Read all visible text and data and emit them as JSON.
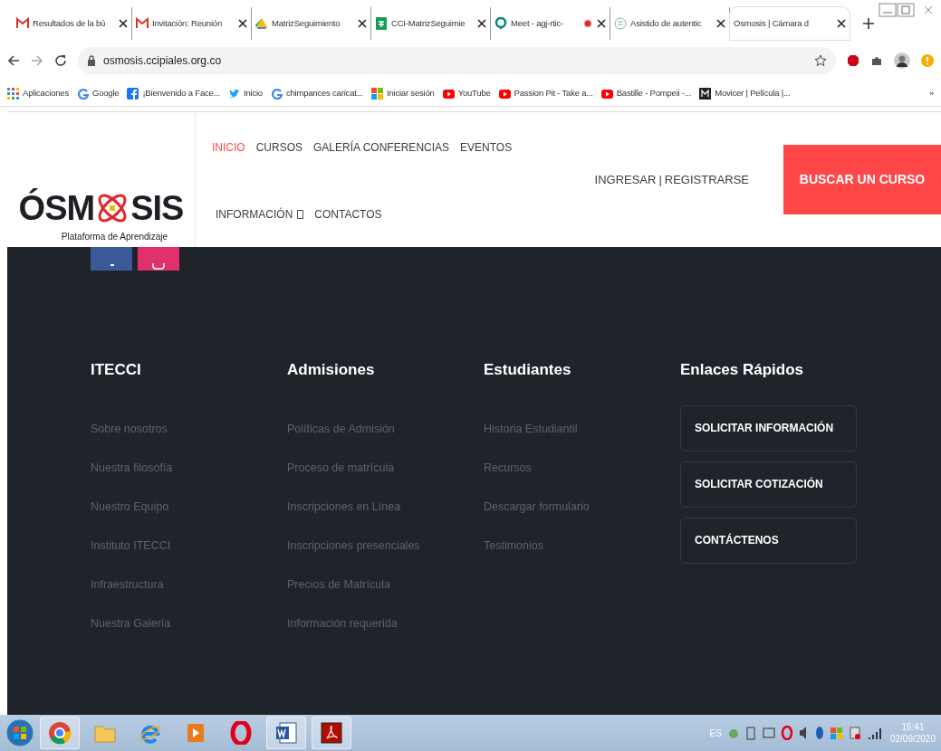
{
  "browser": {
    "tabs": [
      {
        "title": "Resultados de la bú",
        "kind": "gmail",
        "selected": false,
        "recording": false
      },
      {
        "title": "Invitación: Reunión",
        "kind": "gmail",
        "selected": false,
        "recording": false
      },
      {
        "title": "MatrizSeguimiento",
        "kind": "drive",
        "selected": false,
        "recording": false
      },
      {
        "title": "CCI-MatrizSeguimie",
        "kind": "sheets",
        "selected": false,
        "recording": false
      },
      {
        "title": "Meet - agj-rtic-",
        "kind": "meet",
        "selected": false,
        "recording": true
      },
      {
        "title": "Asistido de autentic",
        "kind": "generic",
        "selected": false,
        "recording": false
      },
      {
        "title": "Osmosis | Cámara d",
        "kind": "plain",
        "selected": true,
        "recording": false
      }
    ],
    "address": "osmosis.ccipiales.org.co",
    "bookmarks": [
      {
        "label": "Aplicaciones",
        "kind": "apps"
      },
      {
        "label": "Google",
        "kind": "google"
      },
      {
        "label": "¡Bienvenido a Face...",
        "kind": "facebook"
      },
      {
        "label": "Inicio",
        "kind": "twitter"
      },
      {
        "label": "chimpances caricat...",
        "kind": "google"
      },
      {
        "label": "Iniciar sesión",
        "kind": "windows"
      },
      {
        "label": "YouTube",
        "kind": "youtube"
      },
      {
        "label": "Passion Pit - Take a...",
        "kind": "youtube"
      },
      {
        "label": "Bastille - Pompeii -...",
        "kind": "youtube"
      },
      {
        "label": "Movicer | Película |...",
        "kind": "movicer"
      }
    ],
    "more": "»"
  },
  "header": {
    "logo": {
      "left": "ÓSM",
      "right": "SIS",
      "tagline": "Plataforma de Aprendizaje"
    },
    "nav_rows": [
      [
        {
          "label": "INICIO",
          "selected": true,
          "dropdown": false
        },
        {
          "label": "CURSOS",
          "selected": false,
          "dropdown": false
        },
        {
          "label": "GALERÍA CONFERENCIAS",
          "selected": false,
          "dropdown": false
        },
        {
          "label": "EVENTOS",
          "selected": false,
          "dropdown": false
        }
      ],
      [
        {
          "label": "INFORMACIÓN",
          "selected": false,
          "dropdown": true
        },
        {
          "label": "CONTACTOS",
          "selected": false,
          "dropdown": false
        }
      ]
    ],
    "login": "INGRESAR",
    "separator": "|",
    "register": "REGISTRARSE",
    "cta": "BUSCAR UN CURSO"
  },
  "footer": {
    "columns": [
      {
        "heading": "ITECCI",
        "links": [
          "Sobre nosotros",
          "Nuestra filosofía",
          "Nuestro Equipo",
          "Instituto ITECCI",
          "Infraestructura",
          "Nuestra Galería"
        ]
      },
      {
        "heading": "Admisiones",
        "links": [
          "Políticas de Admisión",
          "Proceso de matrícula",
          "Inscripciones en Línea",
          "Inscripciones presenciales",
          "Precios de Matrícula",
          "Información requerida"
        ]
      },
      {
        "heading": "Estudiantes",
        "links": [
          "Historia Estudiantil",
          "Recursos",
          "Descargar formulario",
          "Testimonios"
        ]
      }
    ],
    "quick_links": {
      "heading": "Enlaces Rápidos",
      "buttons": [
        "SOLICITAR INFORMACIÓN",
        "SOLICITAR COTIZACIÓN",
        "CONTÁCTENOS"
      ]
    }
  },
  "taskbar": {
    "apps": [
      {
        "kind": "chrome",
        "selected": true
      },
      {
        "kind": "folder",
        "selected": false
      },
      {
        "kind": "ie",
        "selected": false
      },
      {
        "kind": "media",
        "selected": false
      },
      {
        "kind": "opera",
        "selected": false
      },
      {
        "kind": "word",
        "selected": true
      },
      {
        "kind": "acrobat",
        "selected": true
      }
    ],
    "language": "ES",
    "time": "15:41",
    "date": "02/09/2020"
  }
}
